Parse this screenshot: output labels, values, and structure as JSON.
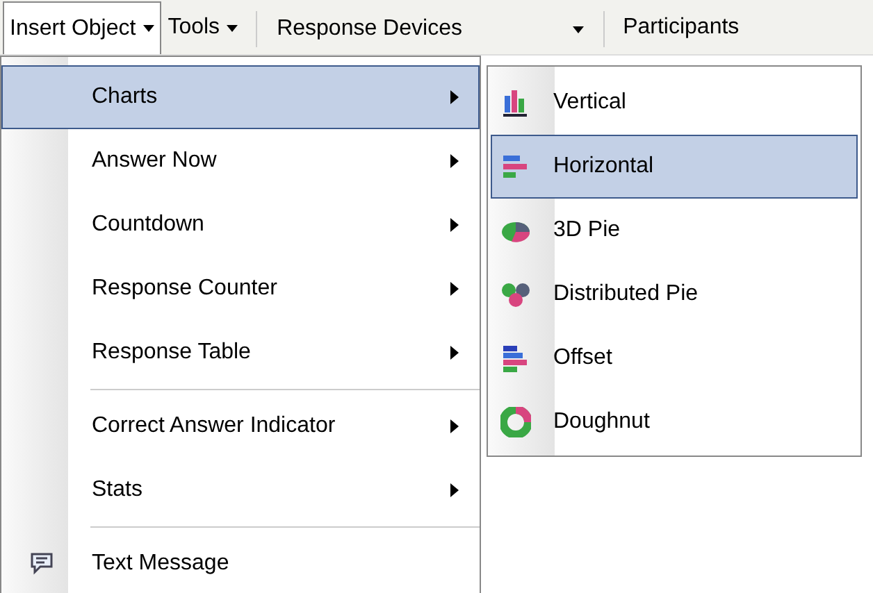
{
  "toolbar": [
    {
      "label": "Insert Object",
      "kind": "menu",
      "pressed": true
    },
    {
      "label": "Tools",
      "kind": "menu",
      "pressed": false
    },
    {
      "label": "Response Devices",
      "kind": "combo",
      "pressed": false
    },
    {
      "label": "Participants",
      "kind": "plain",
      "pressed": false
    }
  ],
  "menu": {
    "groups": [
      [
        {
          "label": "Charts",
          "kind": "submenu",
          "selected": true
        },
        {
          "label": "Answer Now",
          "kind": "submenu",
          "selected": false
        },
        {
          "label": "Countdown",
          "kind": "submenu",
          "selected": false
        },
        {
          "label": "Response Counter",
          "kind": "submenu",
          "selected": false
        },
        {
          "label": "Response Table",
          "kind": "submenu",
          "selected": false
        }
      ],
      [
        {
          "label": "Correct Answer Indicator",
          "kind": "submenu",
          "selected": false
        },
        {
          "label": "Stats",
          "kind": "submenu",
          "selected": false
        }
      ],
      [
        {
          "label": "Text Message",
          "kind": "command",
          "selected": false
        }
      ]
    ]
  },
  "submenu": {
    "items": [
      {
        "label": "Vertical",
        "selected": false
      },
      {
        "label": "Horizontal",
        "selected": true
      },
      {
        "label": "3D Pie",
        "selected": false
      },
      {
        "label": "Distributed Pie",
        "selected": false
      },
      {
        "label": "Offset",
        "selected": false
      },
      {
        "label": "Doughnut",
        "selected": false
      }
    ]
  }
}
